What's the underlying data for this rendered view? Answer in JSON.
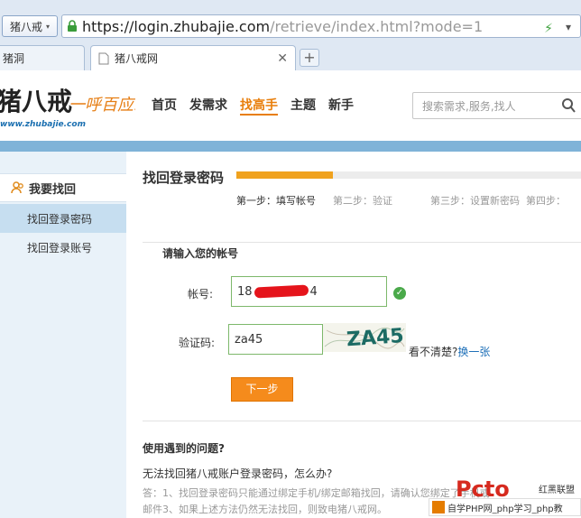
{
  "browser": {
    "site_button": "猪八戒",
    "url_main": "https://login.zhubajie.com",
    "url_rest": "/retrieve/index.html?mode=1",
    "tabs": [
      {
        "label": "猪洞"
      },
      {
        "label": "猪八戒网"
      }
    ],
    "new_tab": "+"
  },
  "header": {
    "logo_domain": "www.zhubajie.com",
    "logo_slogan": "一呼百应!",
    "nav": [
      "首页",
      "发需求",
      "找高手",
      "主题",
      "新手"
    ],
    "search_placeholder": "搜索需求,服务,找人"
  },
  "sidebar": {
    "title": "我要找回",
    "items": [
      {
        "label": "找回登录密码",
        "active": true
      },
      {
        "label": "找回登录账号",
        "active": false
      }
    ]
  },
  "main": {
    "title": "找回登录密码",
    "progress": 0.28,
    "steps": [
      {
        "label": "第一步：填写帐号",
        "current": true
      },
      {
        "label": "第二步：验证",
        "current": false
      },
      {
        "label": "第三步：设置新密码",
        "current": false
      },
      {
        "label": "第四步：",
        "current": false
      }
    ],
    "section_label": "请输入您的帐号",
    "account_label": "帐号:",
    "account_prefix": "18",
    "account_suffix": "4",
    "captcha_label": "验证码:",
    "captcha_value": "za45",
    "captcha_image_text": "ZA45",
    "refresh_prefix": "看不清楚?",
    "refresh_link": "换一张",
    "next_button": "下一步"
  },
  "faq": {
    "title": "使用遇到的问题?",
    "question": "无法找回猪八戒账户登录密码，怎么办?",
    "answer_line1": "答：1、找回登录密码只能通过绑定手机/绑定邮箱找回，请确认您绑定了手机或",
    "answer_line2": "邮件3、如果上述方法仍然无法找回，则致电猪八戒网。"
  },
  "watermark": {
    "brand": "Pcto",
    "side_text": "红黑联盟",
    "banner": "自学PHP网_php学习_php教"
  },
  "colors": {
    "accent": "#f58b1c",
    "progress": "#f0a21e",
    "link": "#1d6fb8",
    "bar": "#7fb3d8",
    "sidebar_bg": "#e9f2f9"
  }
}
